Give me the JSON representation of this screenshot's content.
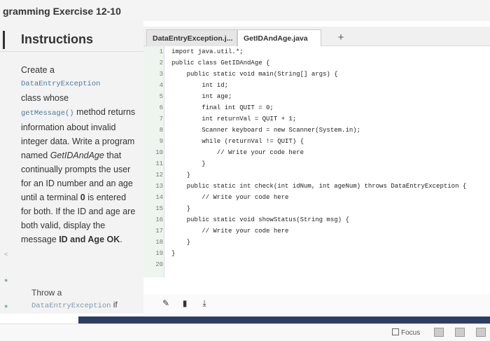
{
  "header": {
    "title": "gramming Exercise 12-10"
  },
  "instructions": {
    "heading": "Instructions",
    "p1": "Create a",
    "p2_code": "DataEntryException",
    "p3": "class whose",
    "p4_code": "getMessage()",
    "p4_rest": " method returns information about invalid integer data. Write a program named ",
    "p4_em": "GetIDAndAge",
    "p4_tail": " that continually prompts the user for an ID number and an age until a terminal ",
    "p4_bold0": "0",
    "p4_tail2": " is entered for both. If the ID and age are both valid, display the message ",
    "p4_bold_msg": "ID and Age OK",
    "p4_end": ".",
    "throw_text": "Throw a",
    "throw_code": "DataEntryException",
    "throw_if": " if"
  },
  "tabs": [
    {
      "label": "DataEntryException.j..."
    },
    {
      "label": "GetIDAndAge.java"
    },
    {
      "label": "+"
    }
  ],
  "code": {
    "line_numbers": [
      "1",
      "2",
      "3",
      "4",
      "5",
      "6",
      "7",
      "8",
      "9",
      "10",
      "11",
      "12",
      "13",
      "14",
      "15",
      "16",
      "17",
      "18",
      "19",
      "20"
    ],
    "lines": [
      "import java.util.*;",
      "public class GetIDAndAge {",
      "    public static void main(String[] args) {",
      "        int id;",
      "        int age;",
      "        final int QUIT = 0;",
      "        int returnVal = QUIT + 1;",
      "        Scanner keyboard = new Scanner(System.in);",
      "        while (returnVal != QUIT) {",
      "            // Write your code here",
      "        }",
      "    }",
      "    public static int check(int idNum, int ageNum) throws DataEntryException {",
      "        // Write your code here",
      "    }",
      "    public static void showStatus(String msg) {",
      "        // Write your code here",
      "    }",
      "}",
      ""
    ]
  },
  "toolbar": {
    "icons": [
      "pencil-icon",
      "trash-icon",
      "download-icon"
    ]
  },
  "status": {
    "focus_label": "Focus"
  }
}
